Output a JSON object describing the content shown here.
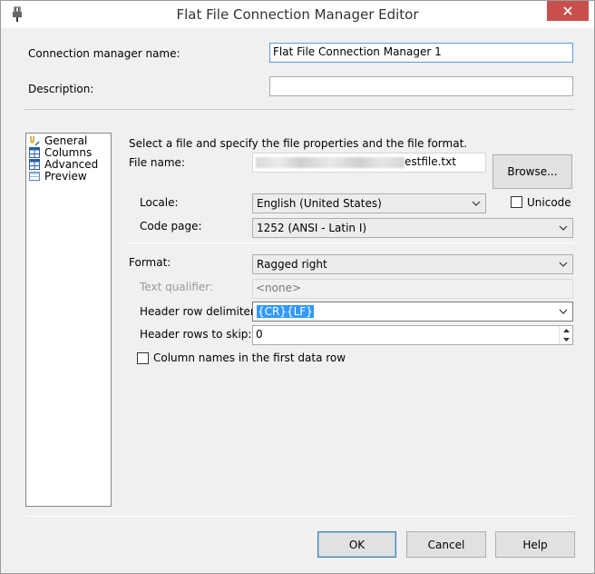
{
  "window": {
    "title": "Flat File Connection Manager Editor"
  },
  "connection_manager_name": {
    "label": "Connection manager name:",
    "value": "Flat File Connection Manager 1"
  },
  "description": {
    "label": "Description:",
    "value": ""
  },
  "nav": {
    "items": [
      {
        "label": "General",
        "icon": "connection-icon",
        "selected": true
      },
      {
        "label": "Columns",
        "icon": "grid-icon"
      },
      {
        "label": "Advanced",
        "icon": "grid-icon"
      },
      {
        "label": "Preview",
        "icon": "table-preview-icon"
      }
    ]
  },
  "general": {
    "instruction": "Select a file and specify the file properties and the file format.",
    "file_name_label": "File name:",
    "file_name_value": "estfile.txt",
    "browse_label": "Browse...",
    "locale_label": "Locale:",
    "locale_value": "English (United States)",
    "unicode_label": "Unicode",
    "unicode_checked": false,
    "code_page_label": "Code page:",
    "code_page_value": "1252  (ANSI - Latin I)",
    "format_label": "Format:",
    "format_value": "Ragged right",
    "text_qualifier_label": "Text qualifier:",
    "text_qualifier_value": "<none>",
    "header_row_delimiter_label": "Header row delimiter:",
    "header_row_delimiter_value": "{CR}{LF}",
    "header_rows_to_skip_label": "Header rows to skip:",
    "header_rows_to_skip_value": "0",
    "column_names_label": "Column names in the first data row",
    "column_names_checked": false
  },
  "footer": {
    "ok_label": "OK",
    "cancel_label": "Cancel",
    "help_label": "Help"
  },
  "colors": {
    "accent": "#3399ff",
    "close_button": "#c7504c",
    "focus_border": "#569de5"
  }
}
